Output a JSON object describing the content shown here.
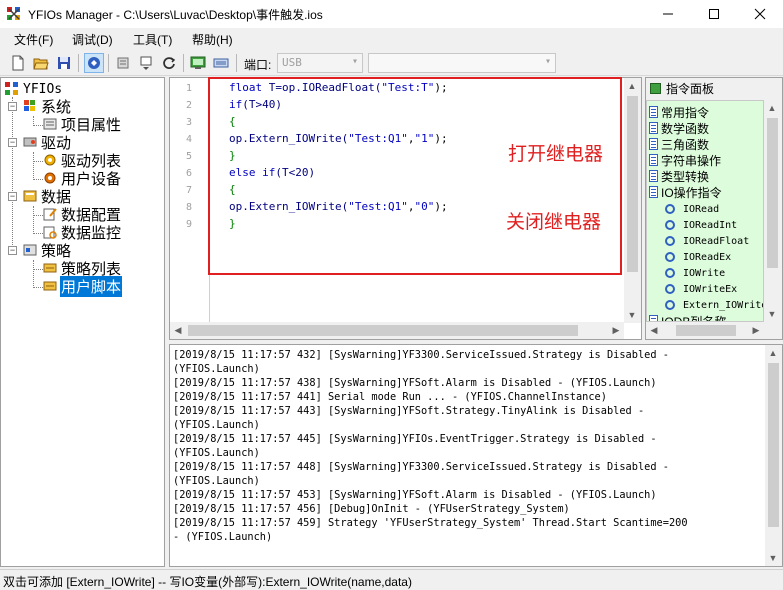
{
  "window": {
    "title": "YFIOs Manager - C:\\Users\\Luvac\\Desktop\\事件触发.ios",
    "minimize_icon": "minimize-icon",
    "maximize_icon": "maximize-icon",
    "close_icon": "close-icon"
  },
  "menu": {
    "items": [
      "文件(F)",
      "调试(D)",
      "工具(T)",
      "帮助(H)"
    ]
  },
  "toolbar": {
    "port_label": "端口:",
    "port_value": "USB",
    "port_arrow": "▾",
    "second_combo_value": "",
    "second_combo_arrow": "▾"
  },
  "tree": {
    "root": "YFIOs",
    "nodes": [
      {
        "label": "系统",
        "children": [
          "项目属性"
        ]
      },
      {
        "label": "驱动",
        "children": [
          "驱动列表",
          "用户设备"
        ]
      },
      {
        "label": "数据",
        "children": [
          "数据配置",
          "数据监控"
        ]
      },
      {
        "label": "策略",
        "children": [
          "策略列表",
          "用户脚本"
        ]
      }
    ],
    "selected": "用户脚本"
  },
  "editor": {
    "line_numbers": [
      "1",
      "2",
      "3",
      "4",
      "5",
      "6",
      "7",
      "8",
      "9"
    ],
    "lines": [
      [
        "float",
        " T=op.IOReadFloat(",
        "\"Test:T\"",
        ");"
      ],
      [
        "if",
        "(T>40)",
        "",
        ""
      ],
      [
        "{",
        "",
        "",
        ""
      ],
      [
        "op.Extern_IOWrite(",
        "\"Test:Q1\"",
        ",",
        "\"1\"",
        ");"
      ],
      [
        "}",
        "",
        "",
        ""
      ],
      [
        "else if",
        "(T<20)",
        "",
        ""
      ],
      [
        "{",
        "",
        "",
        ""
      ],
      [
        "op.Extern_IOWrite(",
        "\"Test:Q1\"",
        ",",
        "\"0\"",
        ");"
      ],
      [
        "}",
        "",
        "",
        ""
      ]
    ],
    "annotation_on": "打开继电器",
    "annotation_off": "关闭继电器"
  },
  "command_panel": {
    "header": "指令面板",
    "categories": [
      "常用指令",
      "数学函数",
      "三角函数",
      "字符串操作",
      "类型转换",
      "IO操作指令"
    ],
    "io_items": [
      "IORead",
      "IOReadInt",
      "IOReadFloat",
      "IOReadEx",
      "IOWrite",
      "IOWriteEx",
      "Extern_IOWrite"
    ],
    "partial_item": "IODB列名称"
  },
  "log": {
    "lines": [
      "[2019/8/15 11:17:57 432] [SysWarning]YF3300.ServiceIssued.Strategy is Disabled -",
      "(YFIOS.Launch)",
      "[2019/8/15 11:17:57 438] [SysWarning]YFSoft.Alarm is Disabled - (YFIOS.Launch)",
      "[2019/8/15 11:17:57 441] Serial mode Run ... - (YFIOS.ChannelInstance)",
      "[2019/8/15 11:17:57 443] [SysWarning]YFSoft.Strategy.TinyAlink is Disabled -",
      "(YFIOS.Launch)",
      "[2019/8/15 11:17:57 445] [SysWarning]YFIOs.EventTrigger.Strategy is Disabled -",
      "(YFIOS.Launch)",
      "[2019/8/15 11:17:57 448] [SysWarning]YF3300.ServiceIssued.Strategy is Disabled -",
      "(YFIOS.Launch)",
      "[2019/8/15 11:17:57 453] [SysWarning]YFSoft.Alarm is Disabled - (YFIOS.Launch)",
      "[2019/8/15 11:17:57 456] [Debug]OnInit - (YFUserStrategy_System)",
      "[2019/8/15 11:17:57 459] Strategy 'YFUserStrategy_System' Thread.Start Scantime=200",
      "- (YFIOS.Launch)"
    ]
  },
  "status": {
    "text": "双击可添加 [Extern_IOWrite] -- 写IO变量(外部写):Extern_IOWrite(name,data)"
  }
}
